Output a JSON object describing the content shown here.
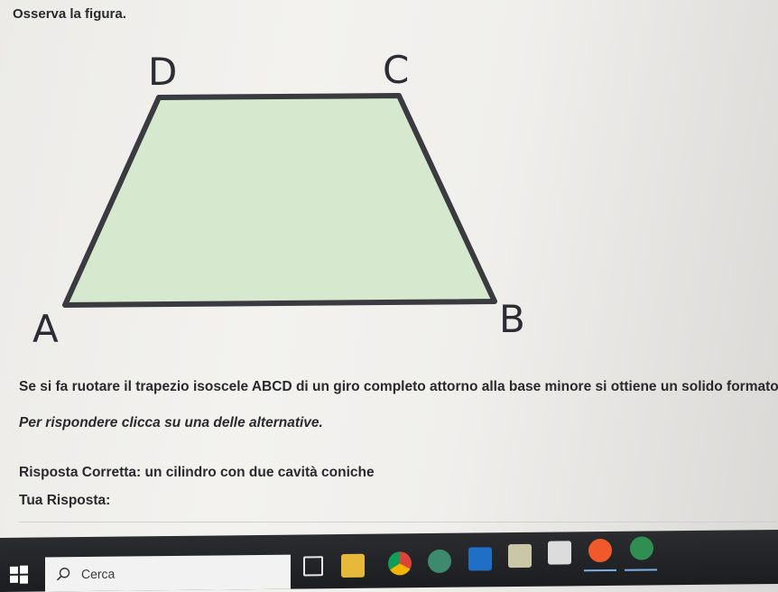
{
  "prompt": "Osserva la figura.",
  "figure": {
    "vertices": {
      "a": "A",
      "b": "B",
      "c": "C",
      "d": "D"
    },
    "fill_color": "#d6e8cd",
    "stroke_color": "#3a3b40"
  },
  "question": "Se si fa ruotare il trapezio isoscele ABCD di un giro completo attorno alla base minore si ottiene un solido formato da:",
  "instruction": "Per rispondere clicca su una delle alternative.",
  "correct_answer_line": "Risposta Corretta: un cilindro con due cavità coniche",
  "your_answer_label": "Tua Risposta:",
  "taskbar": {
    "search_placeholder": "Cerca",
    "apps": [
      {
        "icon": "task-view-icon"
      },
      {
        "icon": "file-explorer-icon"
      },
      {
        "icon": "chrome-icon"
      },
      {
        "icon": "photos-icon"
      },
      {
        "icon": "outlook-icon"
      },
      {
        "icon": "store-icon"
      },
      {
        "icon": "notes-icon"
      },
      {
        "icon": "app-orange-icon"
      },
      {
        "icon": "app-green-icon"
      }
    ]
  }
}
